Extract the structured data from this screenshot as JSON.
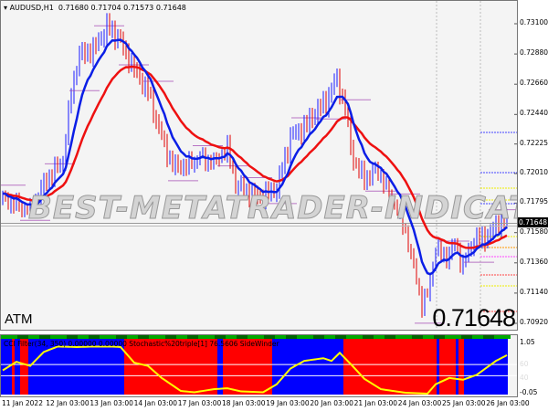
{
  "header": {
    "symbol": "AUDUSD,H1",
    "open": "0.71680",
    "high": "0.71704",
    "low": "0.71573",
    "close": "0.71648"
  },
  "labels": {
    "atm": "ATM",
    "big_price": "0.71648",
    "watermark": "BEST-METATRADER-INDICATORS.COM",
    "current_price": "0.71648"
  },
  "lower_pane": {
    "caption": "CCI Filter(34, 350)   0.00000 0.00000  Stochastic%20triple[1] 76.5606  SideWinder",
    "levels": [
      "1.05",
      "60",
      "40",
      "-0.05"
    ]
  },
  "colors": {
    "bull": "#1a1aff",
    "bear": "#e00000",
    "ma_fast": "#0a1ee6",
    "ma_slow": "#ee1010",
    "pivot": "#a040b0",
    "regime_up": "#0000ff",
    "regime_down": "#ff0000",
    "signal": "#ffff00"
  },
  "chart_data": {
    "type": "candlestick",
    "price_axis": [
      "0.73100",
      "0.72880",
      "0.72660",
      "0.72440",
      "0.72225",
      "0.72010",
      "0.71795",
      "0.71580",
      "0.71360",
      "0.71140",
      "0.70920"
    ],
    "ylim": [
      0.7092,
      0.731
    ],
    "time_axis": [
      "11 Jan 2022",
      "12 Jan 03:00",
      "13 Jan 03:00",
      "14 Jan 03:00",
      "17 Jan 03:00",
      "18 Jan 03:00",
      "19 Jan 03:00",
      "20 Jan 03:00",
      "21 Jan 03:00",
      "24 Jan 03:00",
      "25 Jan 03:00",
      "26 Jan 03:00"
    ],
    "bars": 185,
    "close_keypoints": [
      [
        0,
        0.7184
      ],
      [
        7,
        0.7177
      ],
      [
        10,
        0.7174
      ],
      [
        15,
        0.7194
      ],
      [
        22,
        0.721
      ],
      [
        25,
        0.726
      ],
      [
        28,
        0.7287
      ],
      [
        33,
        0.729
      ],
      [
        38,
        0.7307
      ],
      [
        42,
        0.73
      ],
      [
        47,
        0.728
      ],
      [
        53,
        0.726
      ],
      [
        58,
        0.7227
      ],
      [
        62,
        0.7207
      ],
      [
        67,
        0.7207
      ],
      [
        72,
        0.7214
      ],
      [
        77,
        0.721
      ],
      [
        82,
        0.722
      ],
      [
        85,
        0.7194
      ],
      [
        90,
        0.7187
      ],
      [
        95,
        0.7184
      ],
      [
        100,
        0.719
      ],
      [
        105,
        0.7227
      ],
      [
        110,
        0.7234
      ],
      [
        115,
        0.7247
      ],
      [
        118,
        0.7253
      ],
      [
        122,
        0.727
      ],
      [
        125,
        0.7247
      ],
      [
        128,
        0.721
      ],
      [
        132,
        0.7197
      ],
      [
        137,
        0.7204
      ],
      [
        140,
        0.719
      ],
      [
        143,
        0.718
      ],
      [
        147,
        0.716
      ],
      [
        150,
        0.7134
      ],
      [
        153,
        0.7107
      ],
      [
        155,
        0.7113
      ],
      [
        158,
        0.7147
      ],
      [
        162,
        0.714
      ],
      [
        165,
        0.715
      ],
      [
        168,
        0.7134
      ],
      [
        172,
        0.7153
      ],
      [
        175,
        0.7153
      ],
      [
        178,
        0.7157
      ],
      [
        182,
        0.7167
      ],
      [
        185,
        0.71648
      ]
    ],
    "regime": [
      [
        "up",
        0,
        4
      ],
      [
        "down",
        4,
        5
      ],
      [
        "up",
        5,
        7
      ],
      [
        "down",
        7,
        10
      ],
      [
        "up",
        10,
        45
      ],
      [
        "down",
        45,
        79
      ],
      [
        "up",
        79,
        81
      ],
      [
        "down",
        81,
        99
      ],
      [
        "up",
        99,
        101
      ],
      [
        "down",
        101,
        101
      ],
      [
        "up",
        101,
        125
      ],
      [
        "down",
        125,
        159
      ],
      [
        "up",
        159,
        160
      ],
      [
        "down",
        160,
        166
      ],
      [
        "up",
        166,
        167
      ],
      [
        "down",
        167,
        169
      ],
      [
        "up",
        169,
        185
      ]
    ],
    "signal_keypoints": [
      [
        0,
        0.47
      ],
      [
        5,
        0.66
      ],
      [
        10,
        0.57
      ],
      [
        15,
        0.88
      ],
      [
        20,
        1.0
      ],
      [
        27,
        0.99
      ],
      [
        33,
        1.0
      ],
      [
        40,
        1.0
      ],
      [
        43,
        0.99
      ],
      [
        48,
        0.64
      ],
      [
        53,
        0.57
      ],
      [
        58,
        0.3
      ],
      [
        65,
        0.01
      ],
      [
        70,
        -0.02
      ],
      [
        77,
        0.05
      ],
      [
        82,
        0.07
      ],
      [
        87,
        0.0
      ],
      [
        95,
        -0.02
      ],
      [
        100,
        0.16
      ],
      [
        105,
        0.51
      ],
      [
        110,
        0.68
      ],
      [
        117,
        0.74
      ],
      [
        120,
        0.68
      ],
      [
        123,
        0.86
      ],
      [
        127,
        0.61
      ],
      [
        132,
        0.28
      ],
      [
        138,
        0.05
      ],
      [
        147,
        -0.03
      ],
      [
        155,
        -0.05
      ],
      [
        158,
        0.16
      ],
      [
        163,
        0.3
      ],
      [
        168,
        0.26
      ],
      [
        173,
        0.37
      ],
      [
        180,
        0.68
      ],
      [
        185,
        0.84
      ]
    ],
    "signal_ylim": [
      -0.05,
      1.05
    ],
    "signal_levels": [
      0.6,
      0.35
    ]
  }
}
